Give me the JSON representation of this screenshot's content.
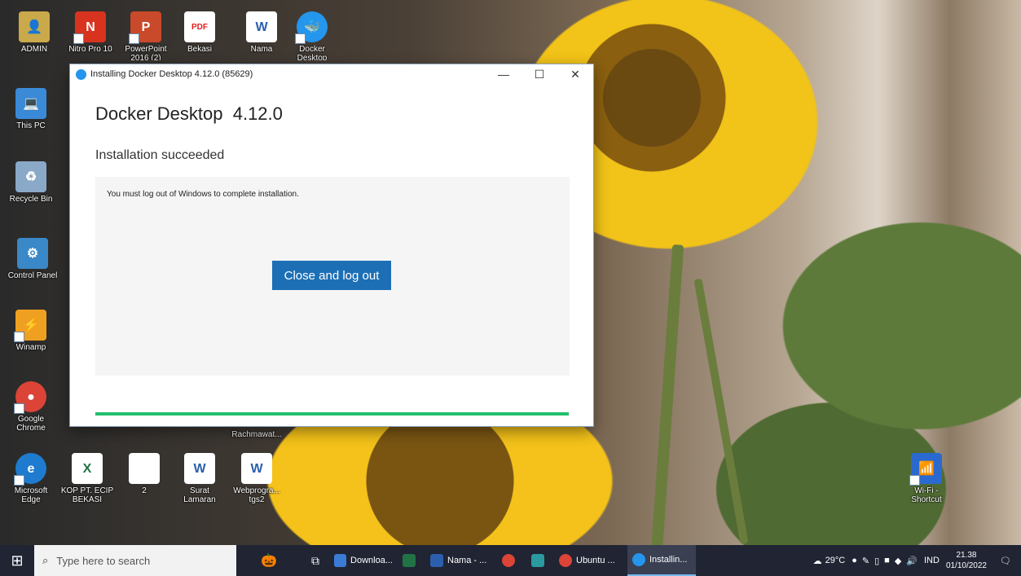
{
  "desktop": {
    "icons": [
      {
        "label": "ADMIN",
        "icon": "user-folder-icon",
        "color": "#c9a94a"
      },
      {
        "label": "Nitro Pro 10",
        "icon": "nitro-pdf-icon",
        "color": "#d8331f"
      },
      {
        "label": "PowerPoint 2016 (2)",
        "icon": "powerpoint-icon",
        "color": "#c94a2a"
      },
      {
        "label": "Bekasi",
        "icon": "pdf-file-icon",
        "color": "#e02020"
      },
      {
        "label": "Nama",
        "icon": "word-document-icon",
        "color": "#2b5fad"
      },
      {
        "label": "Docker Desktop",
        "icon": "docker-icon",
        "color": "#2496ed"
      },
      {
        "label": "This PC",
        "icon": "computer-icon",
        "color": "#3a8ad8"
      },
      {
        "label": "Recycle Bin",
        "icon": "recycle-bin-icon",
        "color": "#8aa8c8"
      },
      {
        "label": "Control Panel",
        "icon": "control-panel-icon",
        "color": "#3a88c8"
      },
      {
        "label": "Winamp",
        "icon": "winamp-icon",
        "color": "#f0a020"
      },
      {
        "label": "Google Chrome",
        "icon": "chrome-icon",
        "color": "#db4437"
      },
      {
        "label": "Microsoft Edge",
        "icon": "edge-icon",
        "color": "#1e7bd0"
      },
      {
        "label": "KOP PT. ECIP BEKASI",
        "icon": "excel-file-icon",
        "color": "#217346"
      },
      {
        "label": "2",
        "icon": "blank-file-icon",
        "color": "#ffffff"
      },
      {
        "label": "Surat Lamaran",
        "icon": "word-document-icon",
        "color": "#2b5fad"
      },
      {
        "label": "Webprogra... tgs2",
        "icon": "word-document-icon",
        "color": "#2b5fad"
      },
      {
        "label": "Rachmawat...",
        "icon": "word-document-icon",
        "color": "#2b5fad"
      },
      {
        "label": "Wi-Fi - Shortcut",
        "icon": "wifi-network-icon",
        "color": "#2a6ad0"
      }
    ]
  },
  "window": {
    "title": "Installing Docker Desktop 4.12.0 (85629)",
    "minimize_glyph": "—",
    "maximize_glyph": "☐",
    "close_glyph": "✕",
    "heading": "Docker Desktop  4.12.0",
    "status": "Installation succeeded",
    "message": "You must log out of Windows to complete installation.",
    "button_label": "Close and log out",
    "progress": 1.0,
    "accent_color": "#1d6fb5",
    "progress_color": "#23c06d"
  },
  "taskbar": {
    "start_glyph": "⊞",
    "search_placeholder": "Type here to search",
    "items": [
      {
        "label": "",
        "icon": "task-view-icon"
      },
      {
        "label": "Downloa...",
        "icon": "downloads-icon"
      },
      {
        "label": "",
        "icon": "excel-icon"
      },
      {
        "label": "Nama - ...",
        "icon": "word-icon"
      },
      {
        "label": "",
        "icon": "chrome-icon"
      },
      {
        "label": "",
        "icon": "app-icon"
      },
      {
        "label": "Ubuntu ...",
        "icon": "chrome-icon"
      },
      {
        "label": "Installin...",
        "icon": "docker-icon"
      }
    ],
    "weather": "29°C",
    "language": "IND",
    "time": "21.38",
    "date": "01/10/2022"
  }
}
